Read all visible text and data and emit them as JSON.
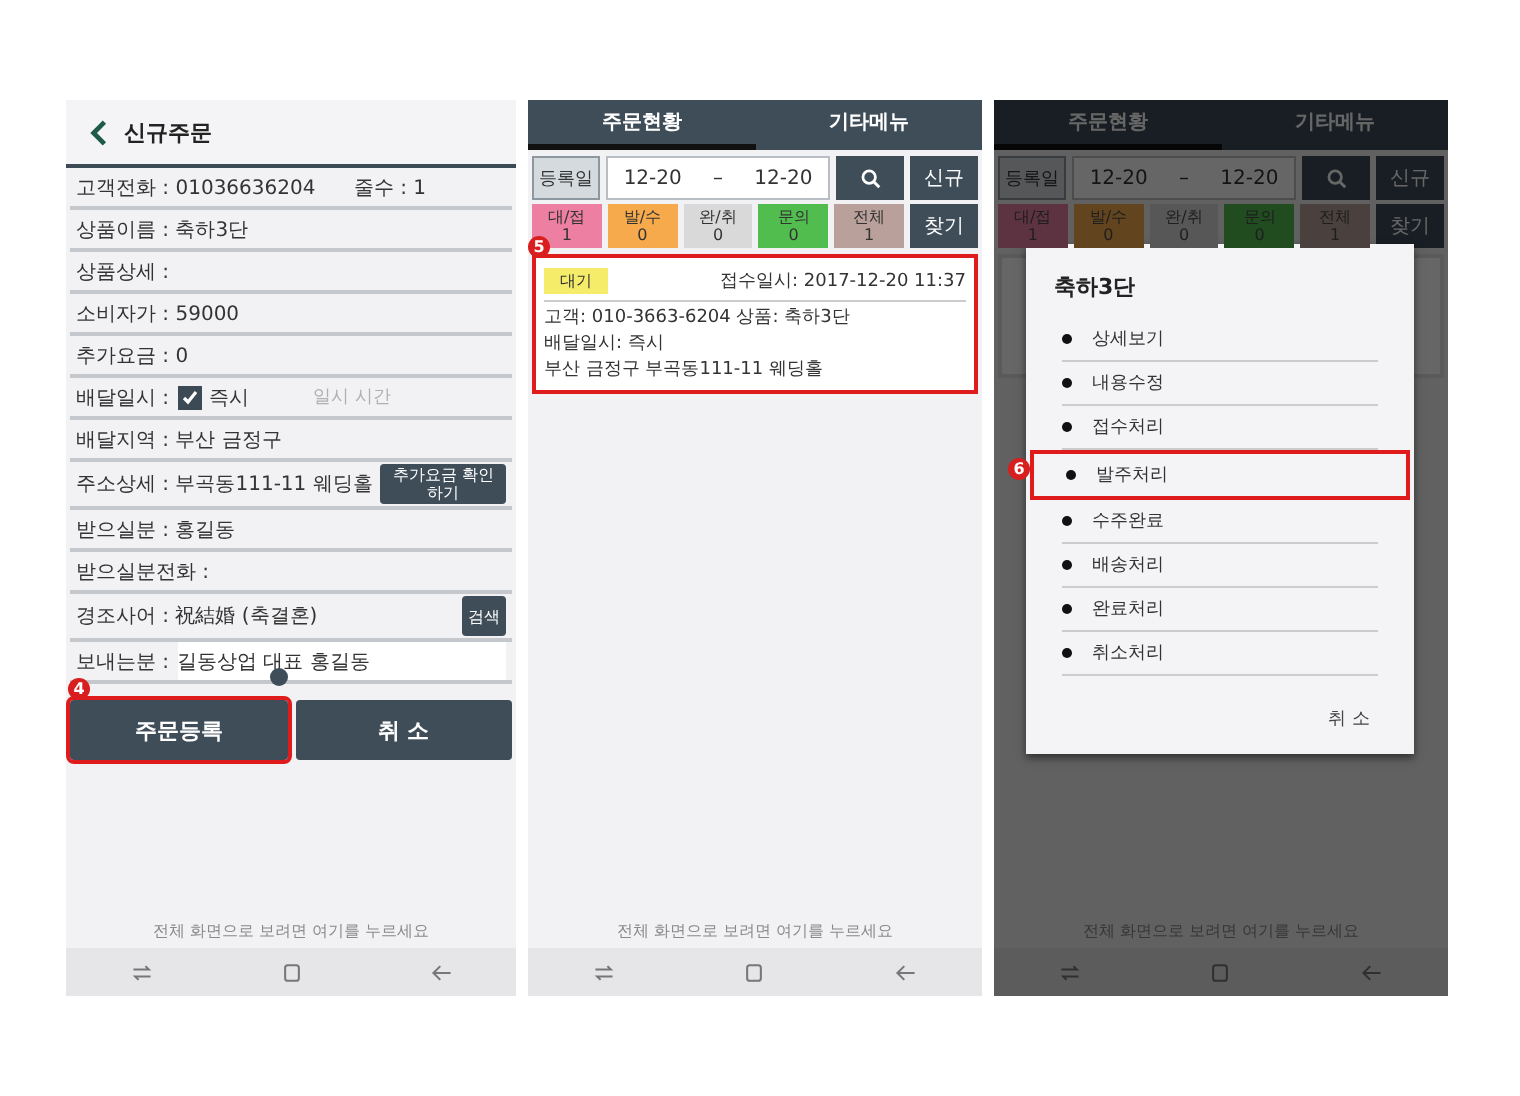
{
  "order_form": {
    "title": "신규주문",
    "fields": [
      {
        "kind": "pair",
        "text": "고객전화 : 01036636204",
        "text_2": "줄수 : 1"
      },
      {
        "kind": "text",
        "text": "상품이름 : 축하3단"
      },
      {
        "kind": "text",
        "text": "상품상세 :"
      },
      {
        "kind": "text",
        "text": "소비자가 : 59000"
      },
      {
        "kind": "text",
        "text": "추가요금 : 0"
      },
      {
        "kind": "checkbox",
        "text": "배달일시 :",
        "checked": true,
        "option": "즉시",
        "placeholder": "일시 시간"
      },
      {
        "kind": "text",
        "text": "배달지역 : 부산 금정구"
      },
      {
        "kind": "button",
        "text": "주소상세 : 부곡동111-11 웨딩홀",
        "button": "추가요금 확인하기"
      },
      {
        "kind": "text",
        "text": "받으실분 : 홍길동"
      },
      {
        "kind": "text",
        "text": "받으실분전화 :"
      },
      {
        "kind": "button",
        "text": "경조사어 : 祝結婚 (축결혼)",
        "button": "검색"
      },
      {
        "kind": "input",
        "text": "보내는분 :",
        "value": "길동상업 대표 홍길동"
      }
    ],
    "buttons": [
      {
        "label": "주문등록",
        "highlighted": true,
        "marker": "4"
      },
      {
        "label": "취 소",
        "highlighted": false
      }
    ],
    "hint": "전체 화면으로 보려면 여기를 누르세요"
  },
  "order_status": {
    "tabs": [
      {
        "label": "주문현황",
        "selected": true
      },
      {
        "label": "기타메뉴",
        "selected": false
      }
    ],
    "date_button": "등록일",
    "date_from": "12-20",
    "date_separator": "–",
    "date_to": "12-20",
    "new_button": "신규",
    "find_button": "찾기",
    "chips": [
      {
        "label": "대/접",
        "count": "1",
        "color": "#ec7fa2"
      },
      {
        "label": "발/수",
        "count": "0",
        "color": "#f6aa4c"
      },
      {
        "label": "완/취",
        "count": "0",
        "color": "#d9d9d9"
      },
      {
        "label": "문의",
        "count": "0",
        "color": "#52bd4f"
      },
      {
        "label": "전체",
        "count": "1",
        "color": "#b9a09a"
      }
    ],
    "card": {
      "highlighted": true,
      "marker": "5",
      "badge": "대기",
      "received": "접수일시: 2017-12-20 11:37",
      "lines": [
        "고객: 010-3663-6204 상품: 축하3단",
        "배달일시: 즉시",
        "부산 금정구 부곡동111-11 웨딩홀"
      ]
    },
    "hint": "전체 화면으로 보려면 여기를 누르세요"
  },
  "order_menu": {
    "tabs": [
      {
        "label": "주문현황",
        "selected": true
      },
      {
        "label": "기타메뉴",
        "selected": false
      }
    ],
    "date_button": "등록일",
    "date_from": "12-20",
    "date_separator": "–",
    "date_to": "12-20",
    "new_button": "신규",
    "find_button": "찾기",
    "chips": [
      {
        "label": "대/접",
        "count": "1",
        "color": "#5e3341"
      },
      {
        "label": "발/수",
        "count": "0",
        "color": "#62441e"
      },
      {
        "label": "완/취",
        "count": "0",
        "color": "#575757"
      },
      {
        "label": "문의",
        "count": "0",
        "color": "#214c20"
      },
      {
        "label": "전체",
        "count": "1",
        "color": "#4a403e"
      }
    ],
    "dialog": {
      "title": "축하3단",
      "items": [
        {
          "label": "상세보기",
          "highlighted": false
        },
        {
          "label": "내용수정",
          "highlighted": false
        },
        {
          "label": "접수처리",
          "highlighted": false
        },
        {
          "label": "발주처리",
          "highlighted": true,
          "marker": "6"
        },
        {
          "label": "수주완료",
          "highlighted": false
        },
        {
          "label": "배송처리",
          "highlighted": false
        },
        {
          "label": "완료처리",
          "highlighted": false
        },
        {
          "label": "취소처리",
          "highlighted": false
        }
      ],
      "cancel": "취 소"
    },
    "hint": "전체 화면으로 보려면 여기를 누르세요"
  }
}
